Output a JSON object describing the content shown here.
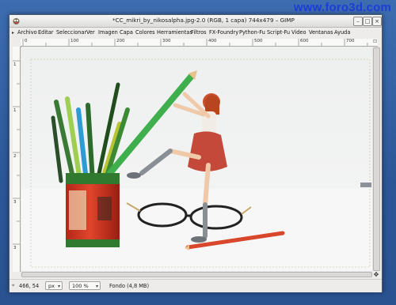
{
  "watermark": "www.foro3d.com",
  "window": {
    "title": "*CC_mikri_by_nikosalpha.jpg-2.0 (RGB, 1 capa) 744x479 – GIMP",
    "controls": {
      "minimize": "–",
      "maximize": "□",
      "close": "×"
    }
  },
  "menu": {
    "items": [
      "Archivo",
      "Editar",
      "Seleccionar",
      "Ver",
      "Imagen",
      "Capa",
      "Colores",
      "Herramientas",
      "Filtros",
      "FX-Foundry",
      "Python-Fu",
      "Script-Fu",
      "Video",
      "Ventanas",
      "Ayuda"
    ]
  },
  "ruler": {
    "h_labels": [
      "0",
      "100",
      "200",
      "300",
      "400",
      "500",
      "600",
      "700"
    ],
    "v_labels": [
      "1",
      "1",
      "2",
      "3",
      "3",
      "4"
    ]
  },
  "status": {
    "coords": "466, 54",
    "unit": "px",
    "zoom": "100 %",
    "info": "Fondo (4,8 MB)"
  },
  "colors": {
    "accent": "#1e3cd8",
    "desktop": "#2c5797",
    "canvas_bg": "#f2f2f2"
  }
}
